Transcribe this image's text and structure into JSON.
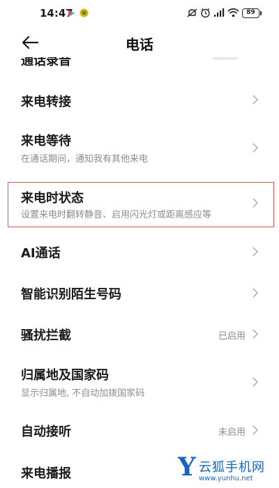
{
  "status_bar": {
    "time": "14:47",
    "battery": "89",
    "icons": [
      "play-store-icon",
      "app-badge-icon",
      "notification-off-icon",
      "alarm-icon",
      "signal-icon",
      "wifi-icon",
      "battery-icon"
    ]
  },
  "header": {
    "title": "电话",
    "back_icon": "back-arrow-icon"
  },
  "clipped_row": {
    "title": "通话录音"
  },
  "rows": [
    {
      "title": "来电转接"
    },
    {
      "title": "来电等待",
      "subtitle": "在通话期间，通知我有其他来电"
    },
    {
      "title": "来电时状态",
      "subtitle": "设置来电时翻转静音、启用闪光灯或距离感应等"
    },
    {
      "title": "AI通话"
    },
    {
      "title": "智能识别陌生号码"
    },
    {
      "title": "骚扰拦截",
      "value": "已启用"
    },
    {
      "title": "归属地及国家码",
      "subtitle": "显示归属地, 不自动加拨国家码"
    },
    {
      "title": "自动接听",
      "value": "未启用"
    },
    {
      "title": "来电播报"
    }
  ],
  "watermark": {
    "letter": "Y",
    "name": "云狐手机网",
    "url": "www.yunhu.net"
  },
  "colors": {
    "highlight_border": "#d9534f",
    "watermark": "#1565c0",
    "secondary_text": "#8c8c8c"
  }
}
